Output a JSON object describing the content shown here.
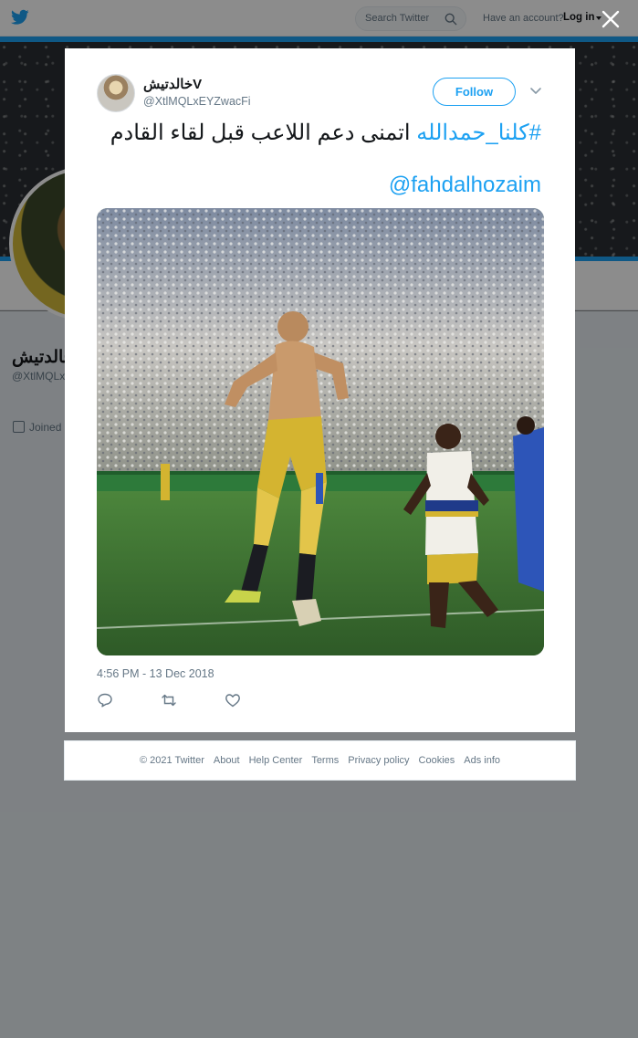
{
  "topbar": {
    "search_placeholder": "Search Twitter",
    "have_account": "Have an account?",
    "login": "Log in"
  },
  "profile": {
    "name": "خالدتيش",
    "handle": "@XtlMQLx",
    "joined_label": "Joined"
  },
  "tweet": {
    "author_name": "خالدتيشV",
    "author_handle": "@XtlMQLxEYZwacFi",
    "follow_label": "Follow",
    "hashtag": "#كلنا_حمدالله",
    "text": " اتمنى دعم اللاعب قبل لقاء القادم",
    "mention": "@fahdalhozaim",
    "timestamp": "4:56 PM - 13 Dec 2018"
  },
  "footer": {
    "copyright": "© 2021 Twitter",
    "links": [
      "About",
      "Help Center",
      "Terms",
      "Privacy policy",
      "Cookies",
      "Ads info"
    ]
  },
  "colors": {
    "accent": "#1da1f2",
    "text": "#14171a",
    "muted": "#657786",
    "overlay": "rgba(0,0,0,0.45)"
  },
  "icons": [
    "twitter-bird-icon",
    "search-icon",
    "close-icon",
    "chevron-down-icon",
    "reply-icon",
    "retweet-icon",
    "like-icon",
    "calendar-icon"
  ]
}
